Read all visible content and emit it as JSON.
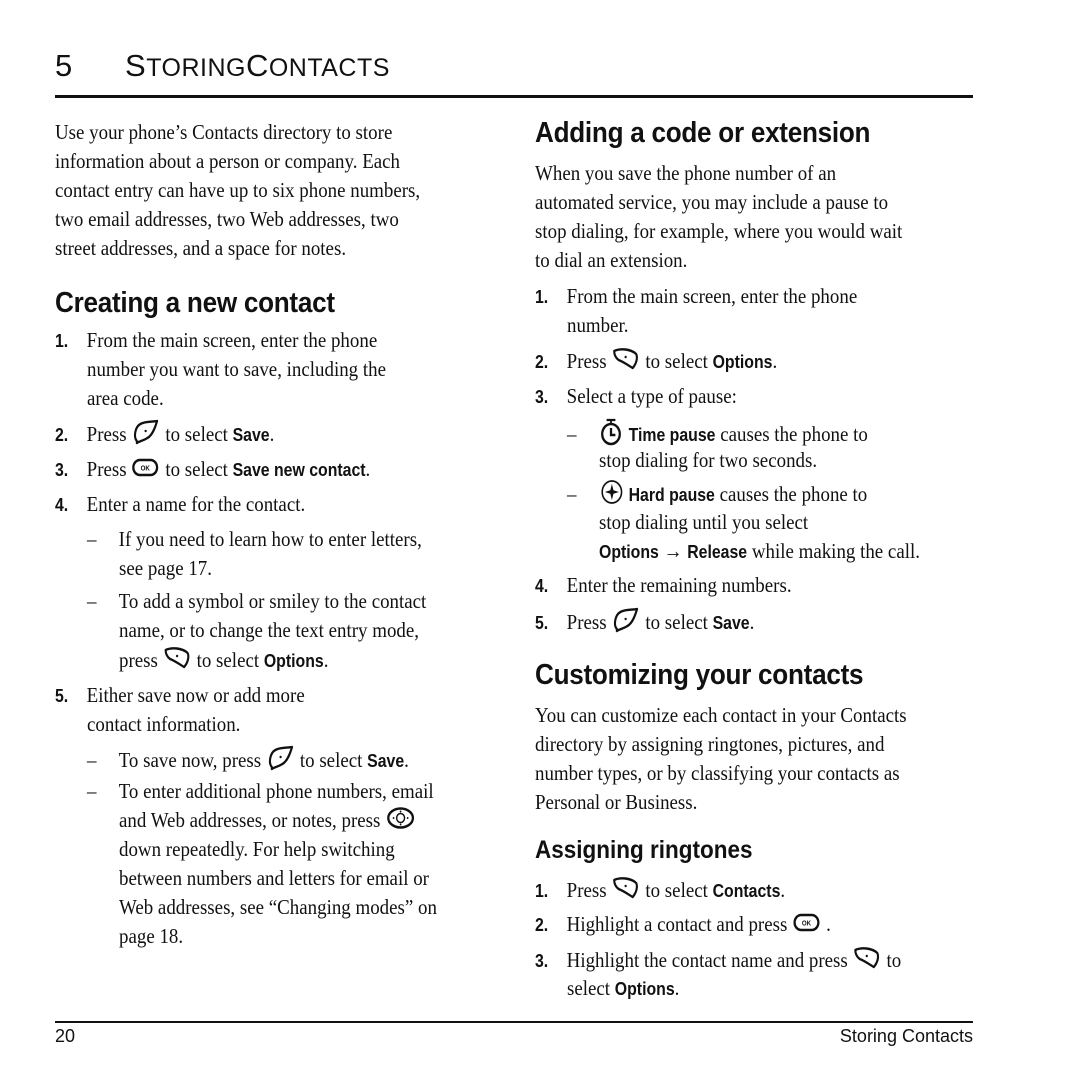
{
  "header": {
    "chapter_number": "5",
    "chapter_title_cap1": "S",
    "chapter_title_rest1": "TORING",
    "chapter_title_cap2": "C",
    "chapter_title_rest2": "ONTACTS"
  },
  "intro": {
    "lines": [
      "Use your phone’s Contacts directory to store",
      "information about a person or company. Each",
      "contact entry can have up to six phone numbers,",
      "two email addresses, two Web addresses, two",
      "street addresses, and a space for notes."
    ]
  },
  "creating": {
    "heading": "Creating a new contact",
    "step1": {
      "num": "1.",
      "lines": [
        "From the main screen, enter the phone",
        "number you want to save, including the",
        "area code."
      ]
    },
    "step2": {
      "num": "2.",
      "pre": "Press",
      "post": "to select",
      "bold": "Save",
      "end": "."
    },
    "step3": {
      "num": "3.",
      "pre": "Press",
      "post": "to select",
      "bold": "Save new contact",
      "end": "."
    },
    "step4": {
      "num": "4.",
      "text": "Enter a name for the contact."
    },
    "sub4a": {
      "dash": "–",
      "lines": [
        "If you need to learn how to enter letters,",
        "see page 17."
      ]
    },
    "sub4b": {
      "dash": "–",
      "lines": [
        "To add a symbol or smiley to the contact",
        "name, or to change the text entry mode,"
      ],
      "pre": "press",
      "post": "to select",
      "bold": "Options",
      "end": "."
    },
    "step5": {
      "num": "5.",
      "lines": [
        "Either save now or add more",
        "contact information."
      ]
    },
    "sub5a": {
      "dash": "–",
      "pre": "To save now, press",
      "post": "to select",
      "bold": "Save",
      "end": "."
    },
    "sub5b": {
      "dash": "–",
      "line1": "To enter additional phone numbers, email",
      "line2_pre": "and Web addresses, or notes, press",
      "lines": [
        "down repeatedly. For help switching",
        "between numbers and letters for email or",
        "Web addresses, see “Changing modes” on",
        "page 18."
      ]
    }
  },
  "adding": {
    "heading": "Adding a code or extension",
    "lines": [
      "When you save the phone number of an",
      "automated service, you may include a pause to",
      "stop dialing, for example, where you would wait",
      "to dial an extension."
    ],
    "step1": {
      "num": "1.",
      "lines": [
        "From the main screen, enter the phone",
        "number."
      ]
    },
    "step2": {
      "num": "2.",
      "pre": "Press",
      "post": "to select",
      "bold": "Options",
      "end": "."
    },
    "step3": {
      "num": "3.",
      "text": "Select a type of pause:"
    },
    "time_pause": {
      "dash": "–",
      "bold": "Time pause",
      "rest": "causes the phone to",
      "line2": "stop dialing for two seconds."
    },
    "hard_pause": {
      "dash": "–",
      "bold": "Hard pause",
      "rest": "causes the phone to",
      "line2": "stop dialing until you select",
      "line3_bold1": "Options",
      "arrow": "→",
      "line3_bold2": "Release",
      "line3_rest": "while making the call."
    },
    "step4": {
      "num": "4.",
      "text": "Enter the remaining numbers."
    },
    "step5": {
      "num": "5.",
      "pre": "Press",
      "post": "to select",
      "bold": "Save",
      "end": "."
    }
  },
  "customizing": {
    "heading": "Customizing your contacts",
    "lines": [
      "You can customize each contact in your Contacts",
      "directory by assigning ringtones, pictures, and",
      "number types, or by classifying your contacts as",
      "Personal or Business."
    ]
  },
  "ringtones": {
    "heading": "Assigning ringtones",
    "step1": {
      "num": "1.",
      "pre": "Press",
      "post": "to select",
      "bold": "Contacts",
      "end": "."
    },
    "step2": {
      "num": "2.",
      "pre": "Highlight a contact and press",
      "end": "."
    },
    "step3": {
      "num": "3.",
      "pre": "Highlight the contact name and press",
      "post": "to",
      "line2": "select",
      "bold": "Options",
      "end": "."
    }
  },
  "footer": {
    "page_number": "20",
    "section_title": "Storing Contacts"
  }
}
